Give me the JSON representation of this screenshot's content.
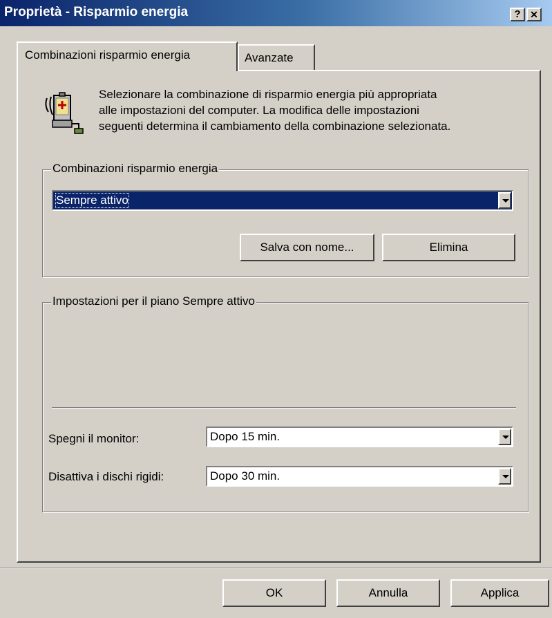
{
  "window": {
    "title": "Proprietà - Risparmio energia",
    "help_button": "?",
    "close_button": "✕"
  },
  "tabs": [
    {
      "label": "Combinazioni risparmio energia",
      "active": true
    },
    {
      "label": "Avanzate",
      "active": false
    }
  ],
  "intro": {
    "icon": "power-battery-icon",
    "lines": [
      "Selezionare la combinazione di risparmio energia più appropriata",
      "alle impostazioni del computer. La modifica delle impostazioni",
      "seguenti determina il cambiamento della combinazione selezionata."
    ]
  },
  "schemes": {
    "group_label": "Combinazioni risparmio energia",
    "selected": "Sempre attivo",
    "save_as_label": "Salva con nome...",
    "delete_label": "Elimina"
  },
  "settings": {
    "group_label": "Impostazioni per il piano Sempre attivo",
    "monitor_label": "Spegni il monitor:",
    "monitor_value": "Dopo 15 min.",
    "disks_label": "Disattiva i dischi rigidi:",
    "disks_value": "Dopo 30 min."
  },
  "footer": {
    "ok_label": "OK",
    "cancel_label": "Annulla",
    "apply_label": "Applica"
  }
}
